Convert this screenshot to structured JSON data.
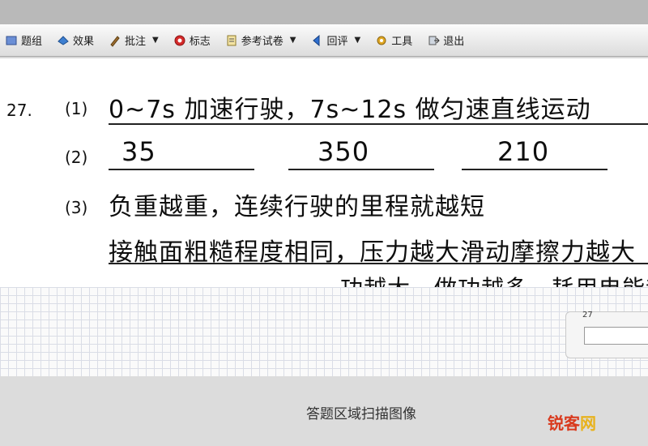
{
  "toolbar": {
    "items": [
      {
        "label": "题组",
        "icon": "question-group-icon"
      },
      {
        "label": "效果",
        "icon": "effect-icon"
      },
      {
        "label": "批注",
        "icon": "pen-icon",
        "dropdown": true
      },
      {
        "label": "标志",
        "icon": "flag-icon"
      },
      {
        "label": "参考试卷",
        "icon": "reference-paper-icon",
        "dropdown": true
      },
      {
        "label": "回评",
        "icon": "back-review-icon",
        "dropdown": true
      },
      {
        "label": "工具",
        "icon": "tools-icon"
      },
      {
        "label": "退出",
        "icon": "exit-icon"
      }
    ]
  },
  "answer": {
    "question_number": "27.",
    "lines": [
      {
        "part": "(1)",
        "text": "0~7s 加速行驶，7s~12s 做匀速直线运动"
      },
      {
        "part": "(2)",
        "blanks": [
          "35",
          "350",
          "210"
        ]
      },
      {
        "part": "(3)",
        "text": "负重越重，连续行驶的里程就越短"
      },
      {
        "part": "",
        "text": "接触面粗糙程度相同，压力越大滑动摩擦力越大"
      },
      {
        "part": "",
        "text": "功越大，做功越多，耗用电能越多"
      }
    ]
  },
  "score_panel": {
    "label": "27",
    "value": ""
  },
  "caption": "答题区域扫描图像",
  "watermark": {
    "part1": "锐客",
    "part2": "网"
  },
  "colors": {
    "watermark_red": "#d93a1e",
    "watermark_yellow": "#e8b21c"
  }
}
